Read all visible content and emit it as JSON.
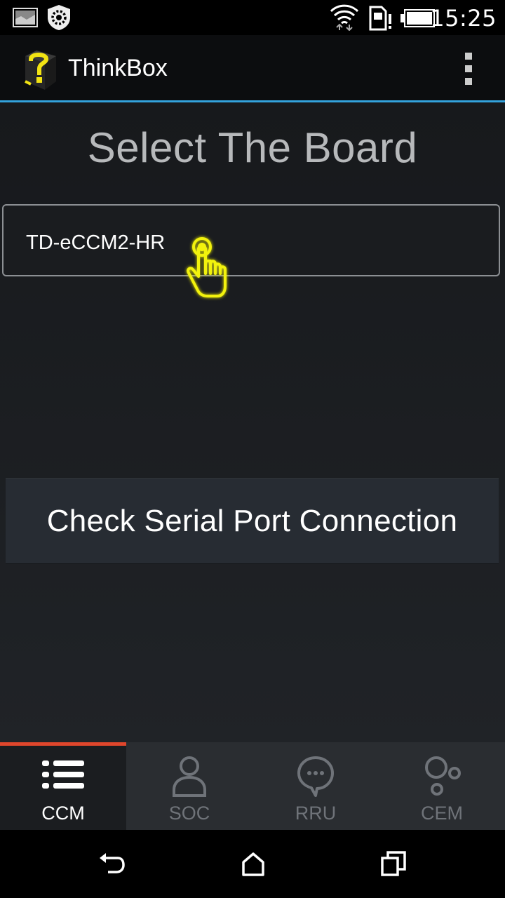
{
  "status_bar": {
    "time": "15:25",
    "icons": [
      "image-notification-icon",
      "settings-notification-icon",
      "wifi-icon",
      "sim-alert-icon",
      "battery-icon"
    ]
  },
  "action_bar": {
    "app_title": "ThinkBox",
    "logo_icon": "thinkbox-logo-icon",
    "overflow_icon": "overflow-menu-icon"
  },
  "main": {
    "heading": "Select The Board",
    "board_select": {
      "selected": "TD-eCCM2-HR"
    },
    "check_button_label": "Check Serial Port Connection"
  },
  "tabs": [
    {
      "label": "CCM",
      "icon": "list-icon",
      "active": true
    },
    {
      "label": "SOC",
      "icon": "person-icon",
      "active": false
    },
    {
      "label": "RRU",
      "icon": "chat-bubble-icon",
      "active": false
    },
    {
      "label": "CEM",
      "icon": "bubbles-icon",
      "active": false
    }
  ],
  "nav_bar": {
    "icons": [
      "back-icon",
      "home-icon",
      "recents-icon"
    ]
  },
  "colors": {
    "accent_line": "#33a2dc",
    "active_tab_indicator": "#e0462c",
    "tap_cursor": "#f2f20a"
  }
}
